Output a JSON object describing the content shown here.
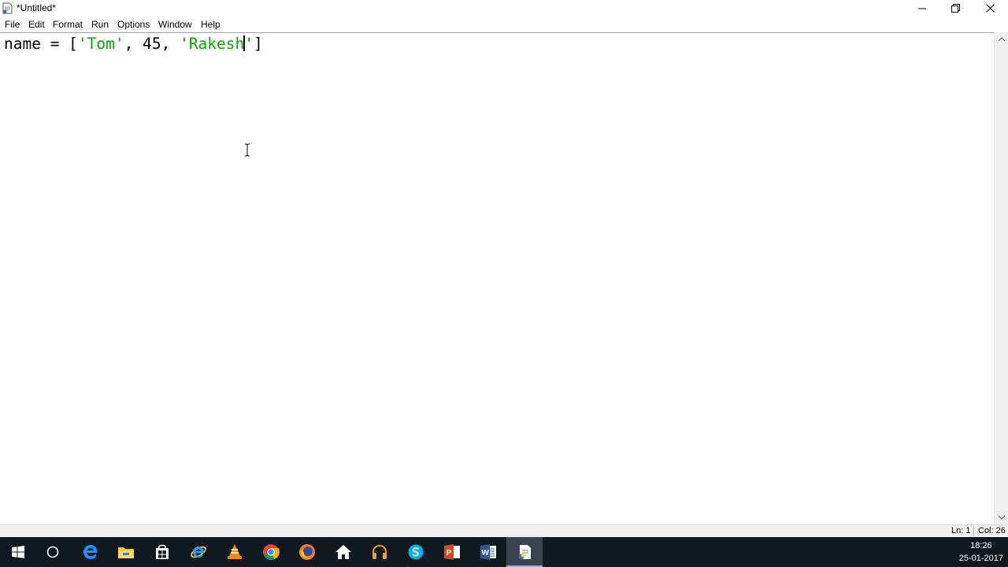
{
  "window": {
    "title": "*Untitled*"
  },
  "menu": {
    "items": [
      "File",
      "Edit",
      "Format",
      "Run",
      "Options",
      "Window",
      "Help"
    ]
  },
  "editor": {
    "code_before_caret": [
      "name = [",
      "'Tom'",
      ", 45, ",
      "'Rakesh"
    ],
    "code_after_caret": [
      "'",
      "]"
    ]
  },
  "status": {
    "line": "Ln: 1",
    "col": "Col: 26"
  },
  "taskbar": {
    "icons": [
      "windows-start-icon",
      "cortana-circle-icon",
      "edge-browser-icon",
      "file-explorer-icon",
      "store-icon",
      "internet-explorer-icon",
      "vlc-icon",
      "chrome-icon",
      "firefox-icon",
      "home-icon",
      "headphones-icon",
      "skype-icon",
      "powerpoint-icon",
      "word-icon",
      "python-idle-icon"
    ],
    "active_icon": "python-idle-icon",
    "time": "18:26",
    "date": "25-01-2017"
  },
  "colors": {
    "string": "#00aa00",
    "taskbar_bg": "#101820",
    "taskbar_active_underline": "#76b9ed"
  }
}
